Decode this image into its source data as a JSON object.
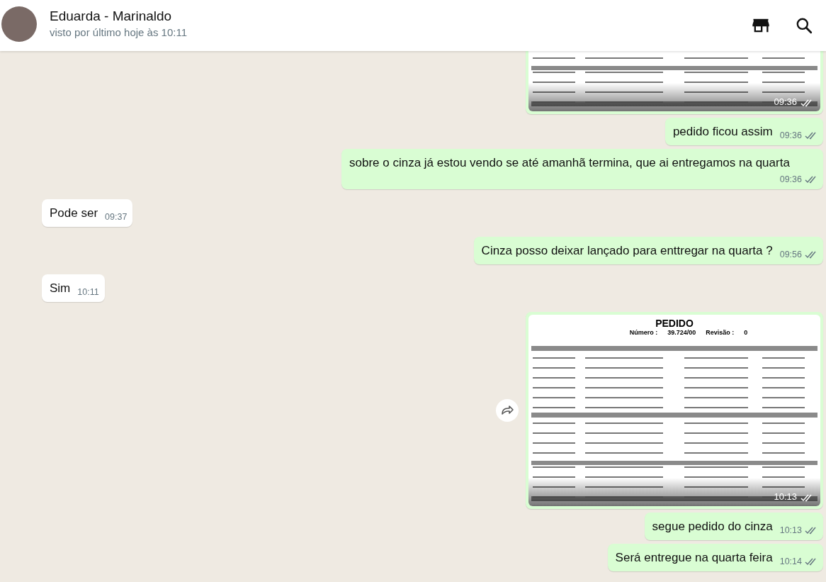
{
  "contact": {
    "name": "Eduarda - Marinaldo",
    "status": "visto por último hoje às 10:11"
  },
  "messages": [
    {
      "kind": "image",
      "outgoing": true,
      "time": "09:36",
      "read": false,
      "forward": false
    },
    {
      "kind": "text",
      "outgoing": true,
      "text": "pedido ficou assim",
      "time": "09:36",
      "read": false
    },
    {
      "kind": "text",
      "outgoing": true,
      "text": "sobre o cinza já estou vendo se até amanhã termina, que ai entregamos na quarta",
      "time": "09:36",
      "read": false
    },
    {
      "kind": "text",
      "outgoing": false,
      "text": "Pode ser",
      "time": "09:37"
    },
    {
      "kind": "text",
      "outgoing": true,
      "text": "Cinza posso deixar lançado para enttregar na quarta ?",
      "time": "09:56",
      "read": false
    },
    {
      "kind": "text",
      "outgoing": false,
      "text": "Sim",
      "time": "10:11"
    },
    {
      "kind": "image",
      "outgoing": true,
      "time": "10:13",
      "read": false,
      "forward": true,
      "doc_title": "PEDIDO",
      "doc_number_label": "Número :",
      "doc_number": "39.724/00",
      "doc_revision_label": "Revisão :",
      "doc_revision": "0"
    },
    {
      "kind": "text",
      "outgoing": true,
      "text": "segue pedido do cinza",
      "time": "10:13",
      "read": false
    },
    {
      "kind": "text",
      "outgoing": true,
      "text": "Será entregue na quarta feira",
      "time": "10:14",
      "read": false
    }
  ]
}
